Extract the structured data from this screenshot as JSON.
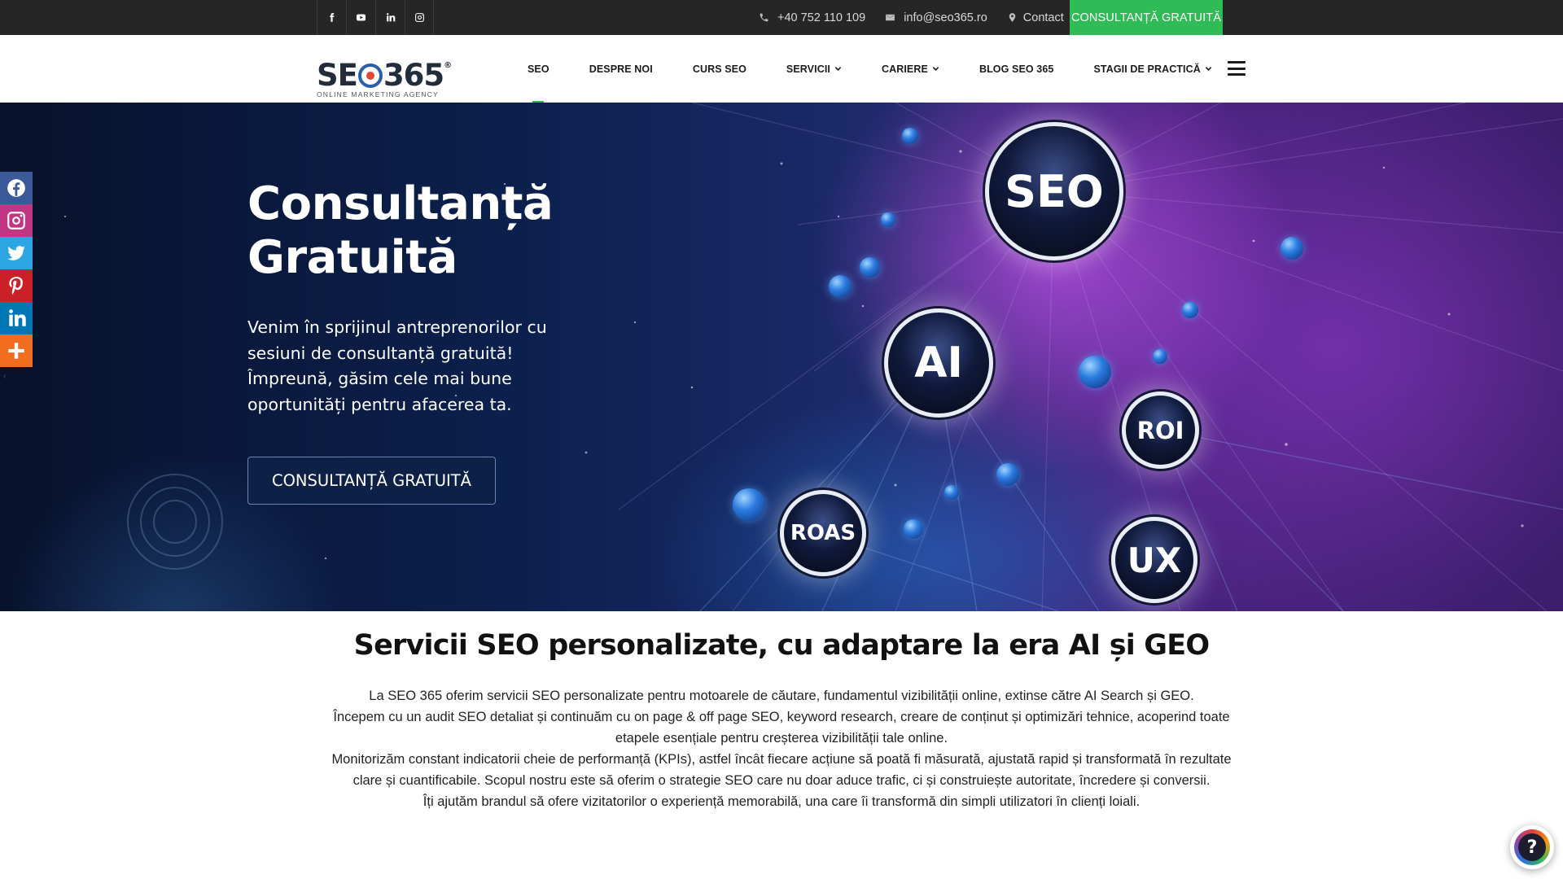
{
  "topbar": {
    "social": [
      {
        "name": "facebook-icon"
      },
      {
        "name": "youtube-icon"
      },
      {
        "name": "linkedin-icon"
      },
      {
        "name": "instagram-icon"
      }
    ],
    "phone": "+40 752 110 109",
    "email": "info@seo365.ro",
    "contact": "Contact",
    "cta": "CONSULTANȚĂ GRATUITĂ"
  },
  "header": {
    "logo_text": "SEO365",
    "logo_sub": "ONLINE MARKETING AGENCY",
    "nav": [
      "SEO",
      "DESPRE NOI",
      "CURS SEO",
      "SERVICII",
      "CARIERE",
      "BLOG SEO 365",
      "STAGII DE PRACTICĂ"
    ],
    "active_item": "SEO"
  },
  "hero": {
    "title_line1": "Consultanță",
    "title_line2": "Gratuită",
    "text": "Venim în sprijinul antreprenorilor cu sesiuni de consultanță gratuită! Împreună, găsim cele mai bune oportunități pentru afacerea ta.",
    "button": "CONSULTANȚĂ GRATUITĂ",
    "orbs": [
      "SEO",
      "AI",
      "ROI",
      "ROAS",
      "UX"
    ]
  },
  "sharebar": [
    "facebook-icon",
    "instagram-icon",
    "twitter-icon",
    "pinterest-icon",
    "linkedin-icon",
    "more-icon"
  ],
  "content": {
    "title": "Servicii SEO personalizate, cu adaptare la era AI și GEO",
    "p1": "La SEO 365 oferim servicii SEO personalizate pentru motoarele de căutare, fundamentul vizibilității online, extinse către AI Search și GEO.",
    "p2": "Începem cu un audit SEO detaliat și continuăm cu on page & off page SEO, keyword research, creare de conținut și optimizări tehnice, acoperind toate etapele esențiale pentru creșterea vizibilității tale online.",
    "p3": "Monitorizăm constant indicatorii cheie de performanță (KPIs), astfel încât fiecare acțiune să poată fi măsurată, ajustată rapid și transformată în rezultate clare și cuantificabile. Scopul nostru este să oferim o strategie SEO care nu doar aduce trafic, ci și construiește autoritate, încredere și conversii.",
    "p4": "Îți ajutăm brandul să ofere vizitatorilor o experiență memorabilă, una care îi transformă din simpli utilizatori în clienți loiali."
  },
  "colors": {
    "topbar_bg": "#262626",
    "cta_green": "#2fbb56",
    "hero_button_bg": "#0d2046",
    "facebook": "#3b5998",
    "instagram": "#c13584",
    "twitter": "#2ba6e3",
    "pinterest": "#cb2027",
    "linkedin": "#0077b5",
    "more": "#f36d21"
  }
}
